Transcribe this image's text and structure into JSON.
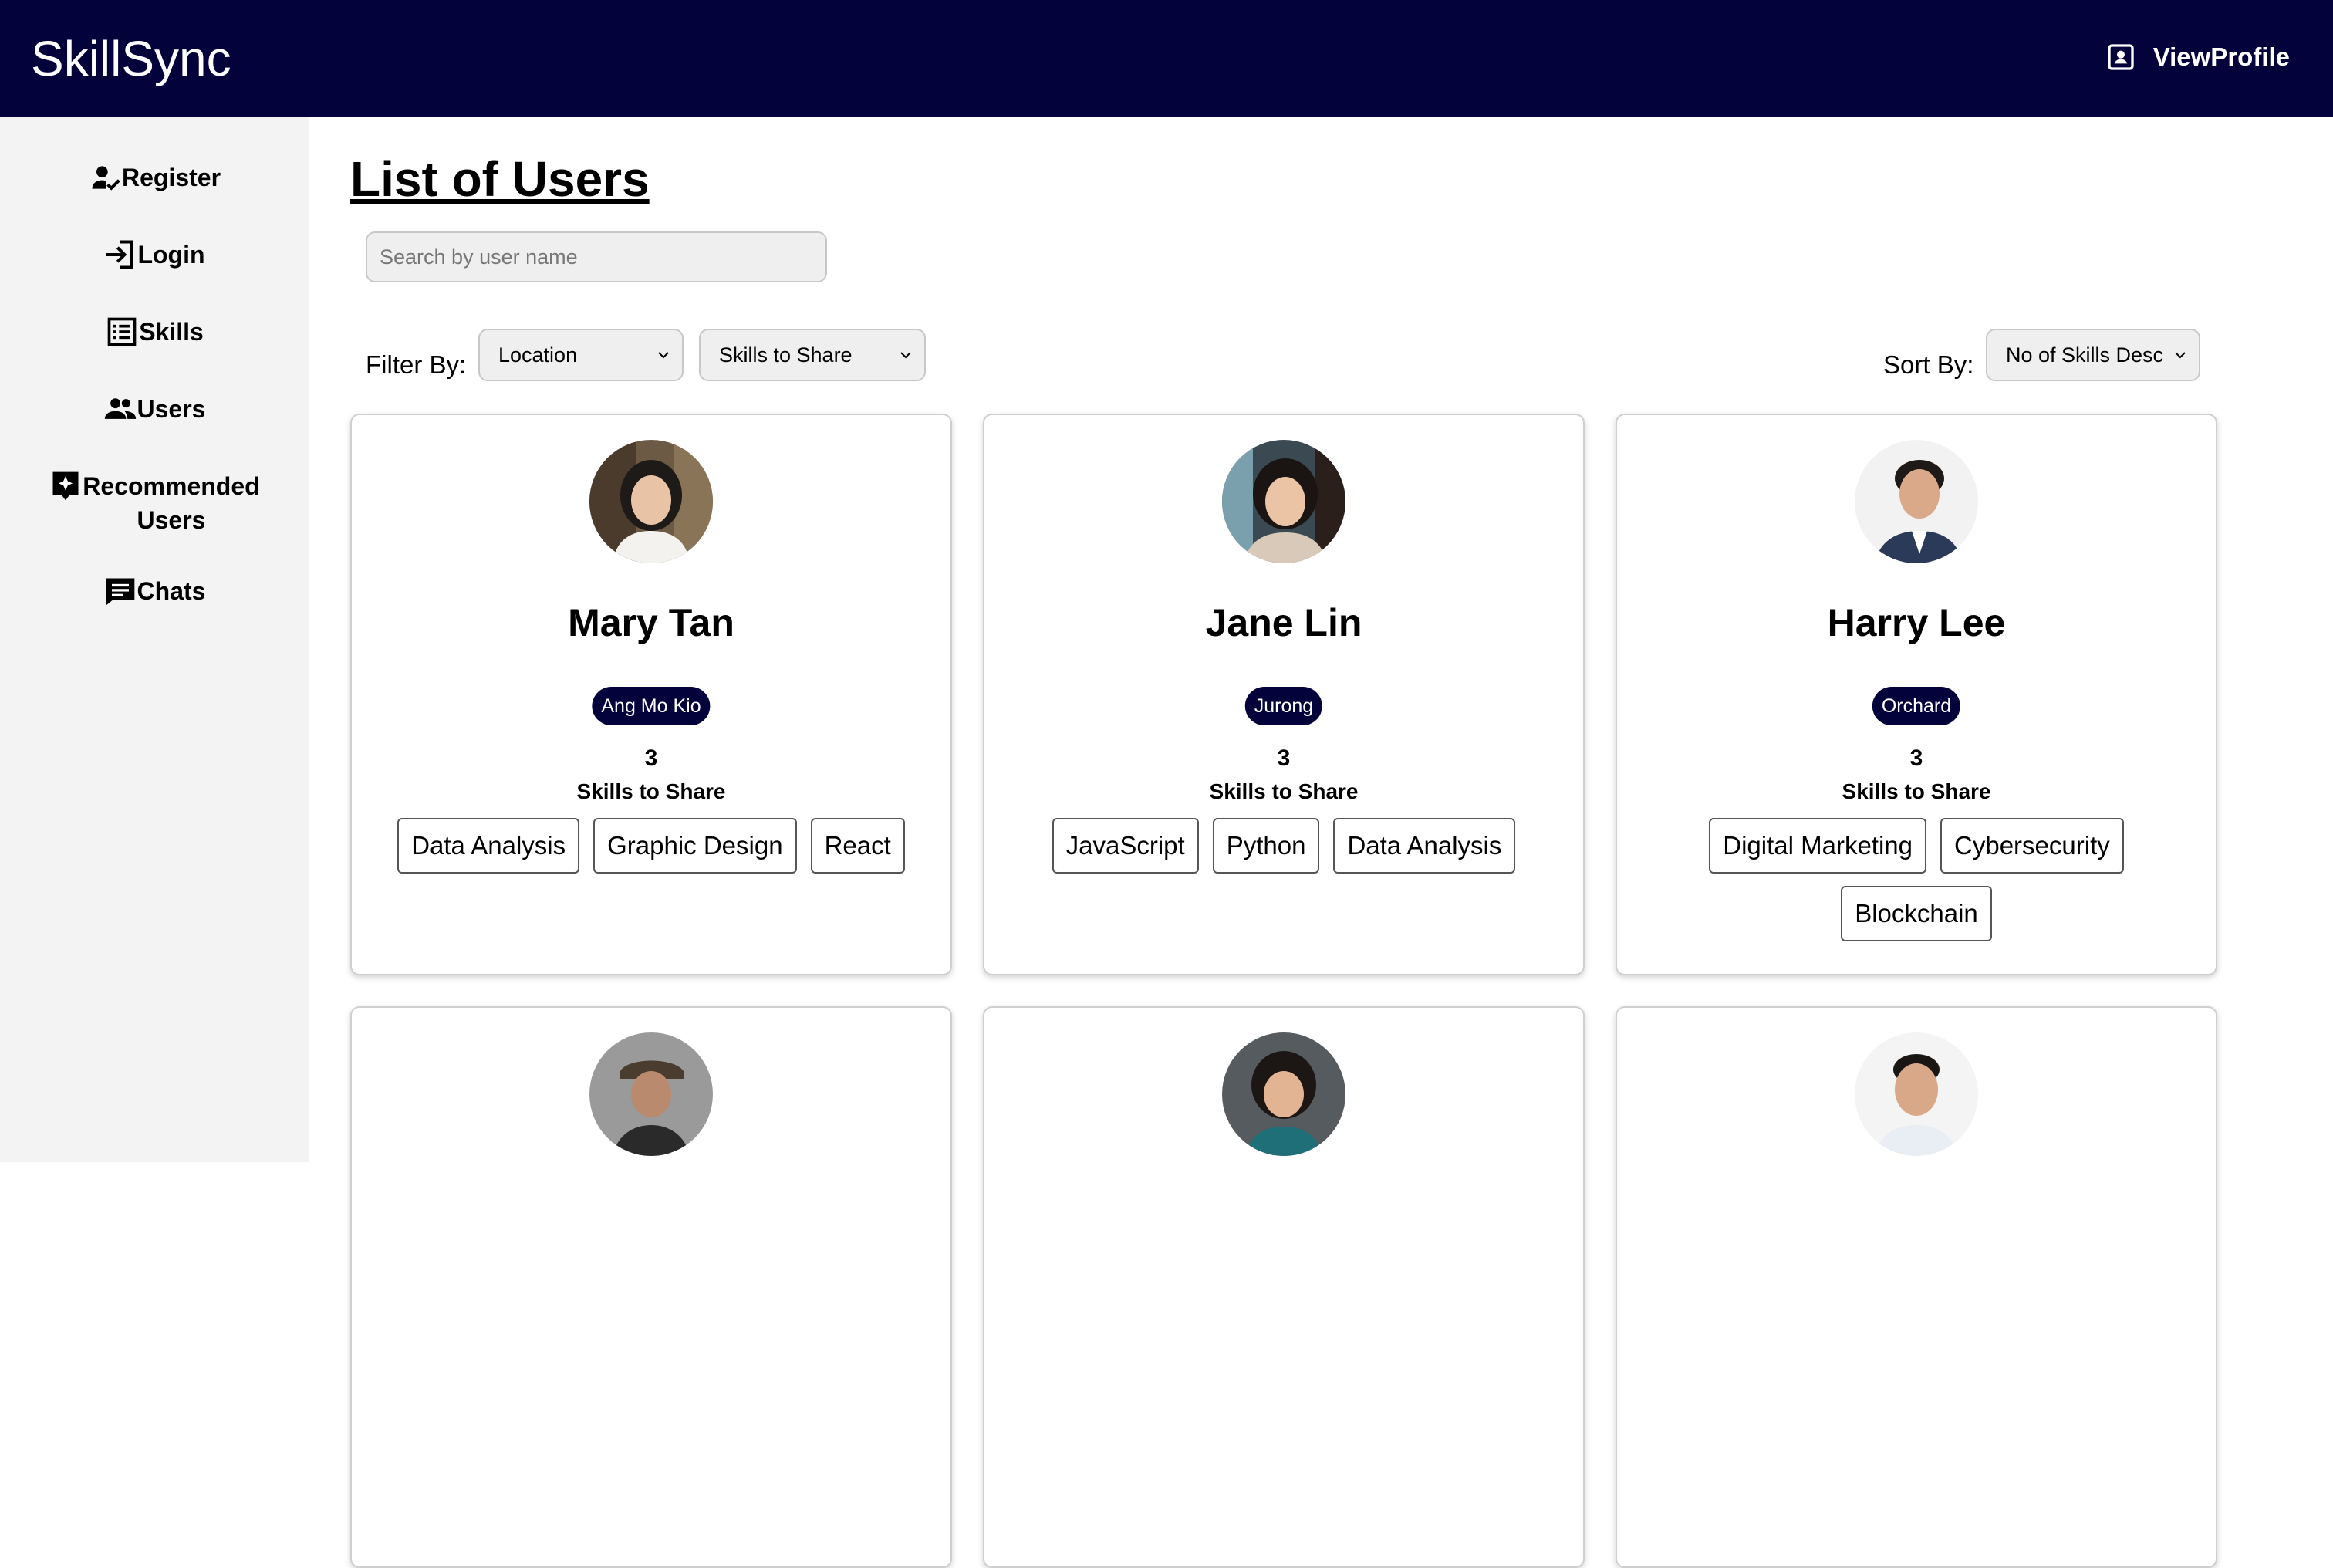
{
  "app": {
    "title": "SkillSync"
  },
  "header": {
    "view_profile_label": "ViewProfile",
    "view_profile_icon": "profile-icon"
  },
  "sidebar": {
    "items": [
      {
        "label": "Register",
        "icon": "person-check-icon"
      },
      {
        "label": "Login",
        "icon": "login-icon"
      },
      {
        "label": "Skills",
        "icon": "list-icon"
      },
      {
        "label": "Users",
        "icon": "group-icon"
      },
      {
        "label_line1": "Recommended",
        "label_line2": "Users",
        "icon": "sparkle-icon"
      },
      {
        "label": "Chats",
        "icon": "chat-icon"
      }
    ]
  },
  "main": {
    "title": "List of Users",
    "search": {
      "placeholder": "Search by user name",
      "value": ""
    },
    "filter_label": "Filter By:",
    "filter_location": "Location",
    "filter_skills": "Skills to Share",
    "sort_label": "Sort By:",
    "sort_value": "No of Skills Desc"
  },
  "users": [
    {
      "name": "Mary Tan",
      "location": "Ang Mo Kio",
      "skill_count": "3",
      "skills_label": "Skills to Share",
      "skills": [
        "Data Analysis",
        "Graphic Design",
        "React"
      ]
    },
    {
      "name": "Jane Lin",
      "location": "Jurong",
      "skill_count": "3",
      "skills_label": "Skills to Share",
      "skills": [
        "JavaScript",
        "Python",
        "Data Analysis"
      ]
    },
    {
      "name": "Harry Lee",
      "location": "Orchard",
      "skill_count": "3",
      "skills_label": "Skills to Share",
      "skills": [
        "Digital Marketing",
        "Cybersecurity",
        "Blockchain"
      ]
    }
  ],
  "colors": {
    "navy": "#03023b",
    "sidebar_bg": "#f3f3f3"
  }
}
